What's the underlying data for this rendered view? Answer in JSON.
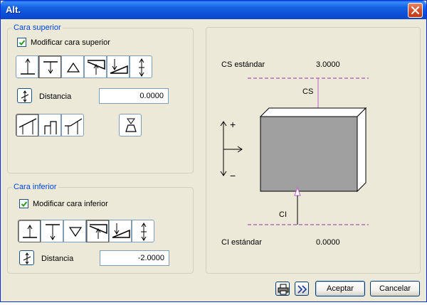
{
  "window": {
    "title": "Alt.",
    "close_icon": "close-icon"
  },
  "top_group": {
    "title": "Cara superior",
    "checkbox_label": "Modificar cara superior",
    "checked": true,
    "distance_label": "Distancia",
    "distance_value": "0.0000",
    "tool_icons": [
      "align-top-up-icon",
      "align-top-down-icon",
      "triangle-up-icon",
      "slope-up-icon",
      "slope-down-icon",
      "up-down-icon"
    ],
    "shape_icons": [
      "sloped-roof-icon",
      "step-roof-icon",
      "partial-slope-icon",
      "trapezoid-icon"
    ]
  },
  "bottom_group": {
    "title": "Cara inferior",
    "checkbox_label": "Modificar cara inferior",
    "checked": true,
    "distance_label": "Distancia",
    "distance_value": "-2.0000",
    "tool_icons": [
      "align-bottom-up-icon",
      "align-bottom-down-icon",
      "triangle-down-icon",
      "slope-up-icon",
      "slope-down-icon",
      "up-down-icon"
    ]
  },
  "preview": {
    "cs_label": "CS estándar",
    "cs_value": "3.0000",
    "cs_marker": "CS",
    "ci_label": "CI estándar",
    "ci_value": "0.0000",
    "ci_marker": "CI",
    "axis_plus": "+",
    "axis_minus": "−",
    "guide_color": "#8b2fae",
    "arrow_color": "#c060d0",
    "box_fill": "#a0a0a0"
  },
  "footer": {
    "print_icon": "printer-icon",
    "expand_icon": "double-chevron-right-icon",
    "ok_label": "Aceptar",
    "cancel_label": "Cancelar"
  }
}
